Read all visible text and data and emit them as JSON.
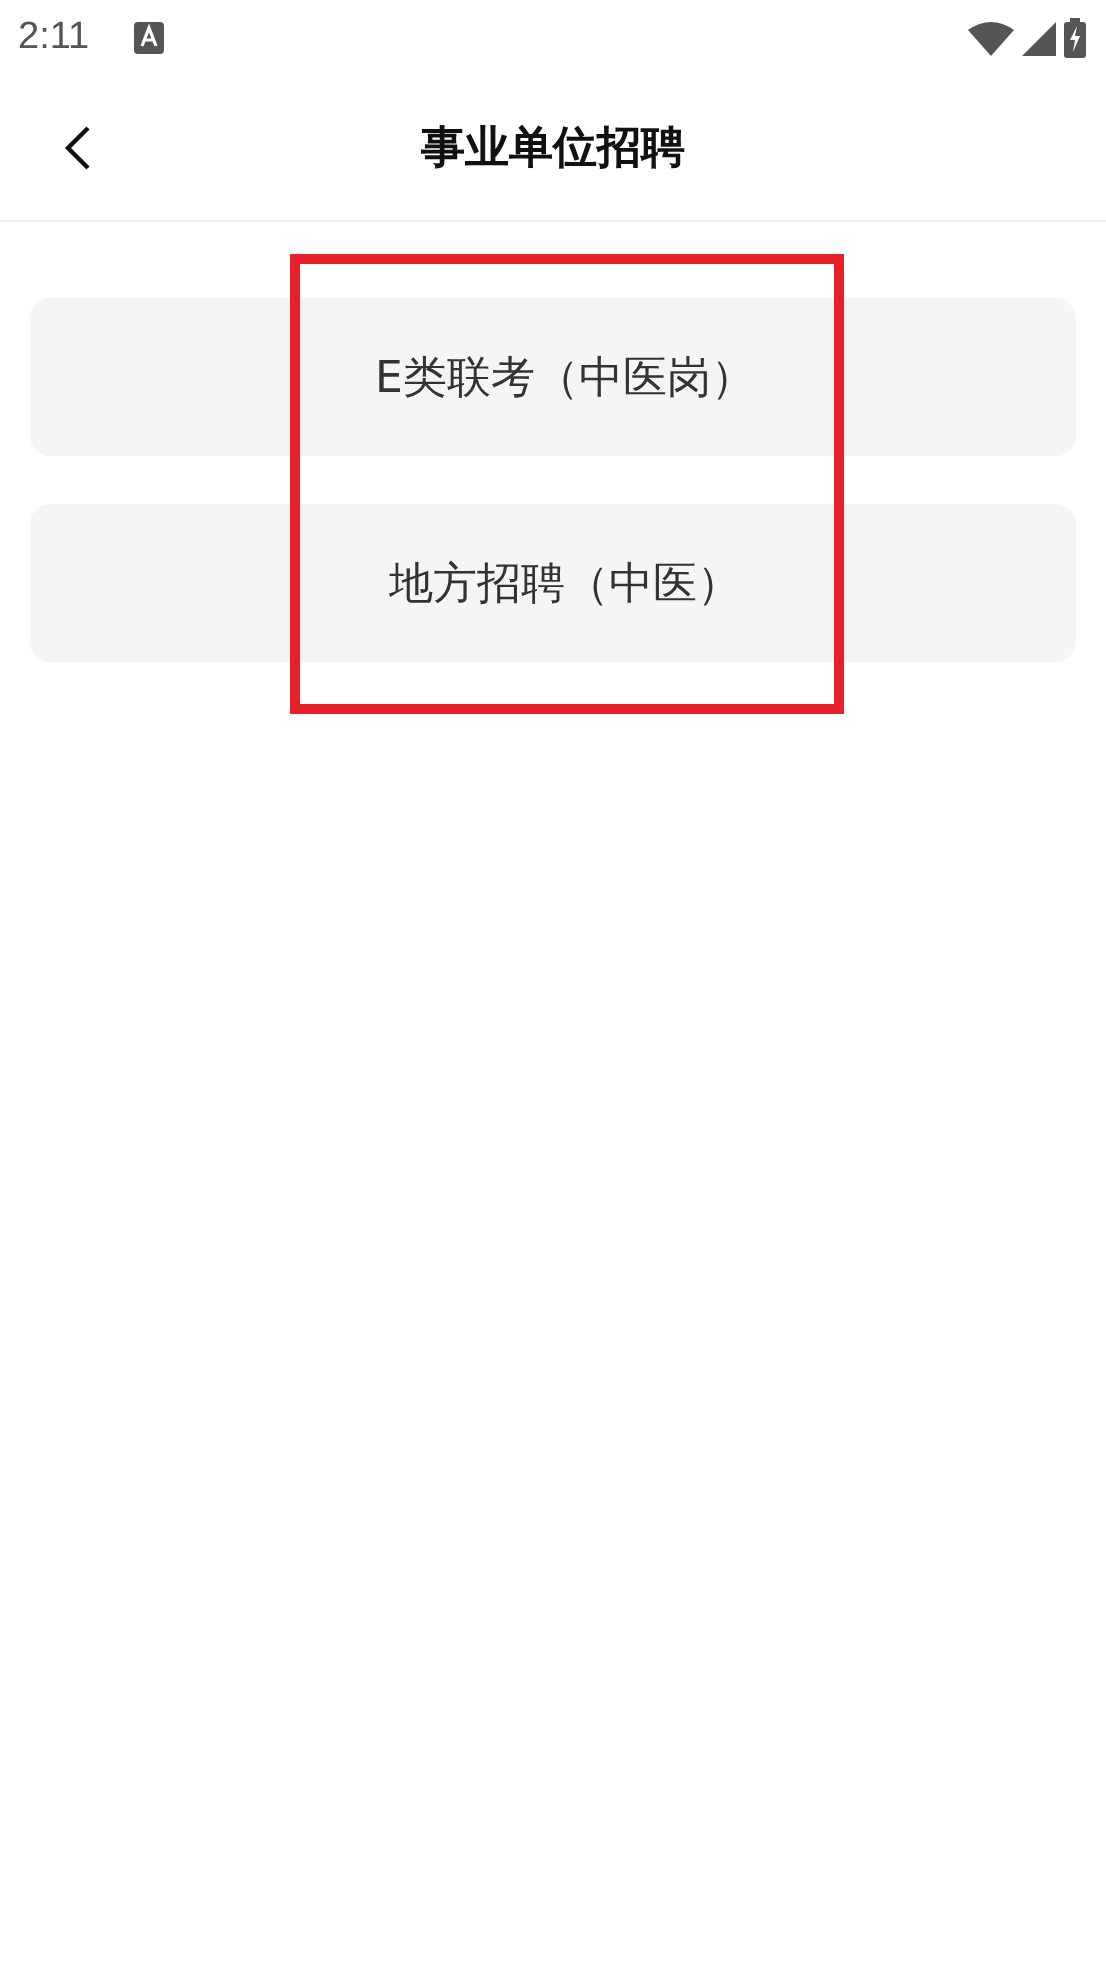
{
  "status_bar": {
    "time": "2:11"
  },
  "header": {
    "title": "事业单位招聘"
  },
  "items": [
    {
      "label": "E类联考（中医岗）"
    },
    {
      "label": "地方招聘（中医）"
    }
  ],
  "highlight_box": true
}
